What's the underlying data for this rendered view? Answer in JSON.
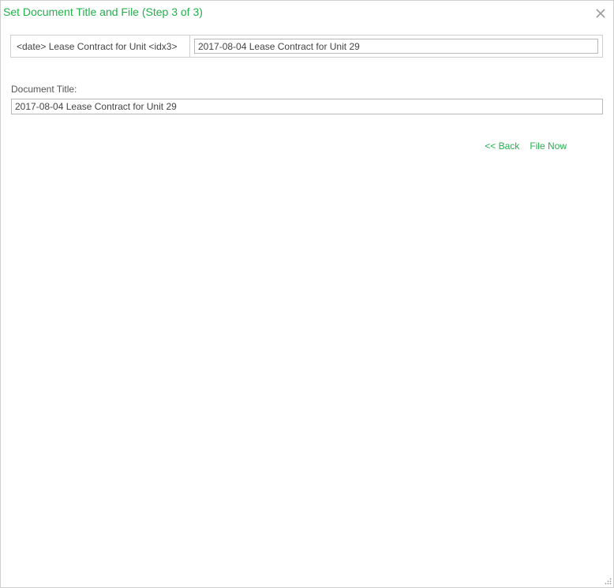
{
  "dialog": {
    "title": "Set Document Title and File (Step 3 of 3)",
    "close_icon": "close-icon"
  },
  "mapping": {
    "pattern_label": "<date> Lease Contract for Unit <idx3>",
    "result_value": "2017-08-04 Lease Contract for Unit 29"
  },
  "document_title": {
    "label": "Document Title:",
    "value": "2017-08-04 Lease Contract for Unit 29"
  },
  "actions": {
    "back_label": "<< Back",
    "file_now_label": "File Now"
  },
  "colors": {
    "accent": "#22b14c",
    "border": "#cfcfcf",
    "text": "#444444"
  }
}
